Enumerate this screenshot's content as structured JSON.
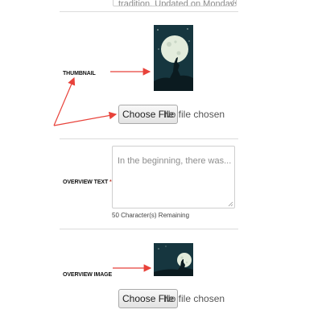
{
  "top_field": {
    "value_fragment": "tradition. Updated on Mondays."
  },
  "thumbnail": {
    "label": "THUMBNAIL",
    "image_icon": "howling-wolf-moon-portrait",
    "file_button": "Choose File",
    "file_status": "No file chosen"
  },
  "overview_text": {
    "label": "OVERVIEW TEXT",
    "required_marker": "*",
    "placeholder": "In the beginning, there was...",
    "remaining": "50 Character(s) Remaining"
  },
  "overview_image": {
    "label": "OVERVIEW IMAGE",
    "image_icon": "howling-wolf-moon-landscape",
    "file_button": "Choose File",
    "file_status": "No file chosen"
  },
  "colors": {
    "annotation_arrow": "#e8423a",
    "image_background": "#16363f",
    "moon": "#e3ecdc"
  }
}
